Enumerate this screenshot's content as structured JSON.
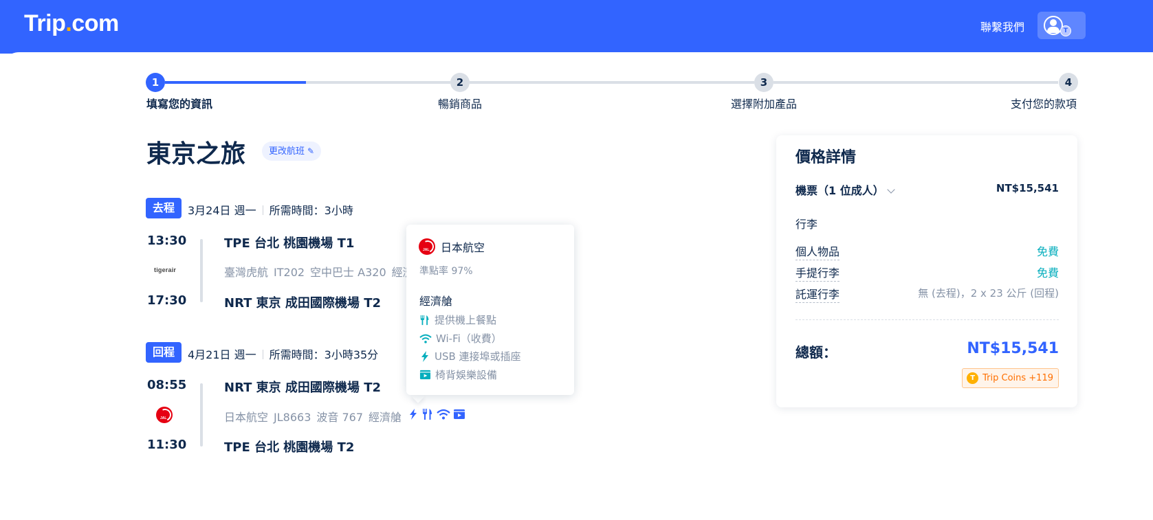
{
  "header": {
    "logo_main": "Trip",
    "logo_dot": ".",
    "logo_suffix": "com",
    "contact_label": "聯繫我們",
    "account_badge": "T"
  },
  "steps": [
    {
      "num": "1",
      "label": "填寫您的資訊",
      "active": true
    },
    {
      "num": "2",
      "label": "暢銷商品",
      "active": false
    },
    {
      "num": "3",
      "label": "選擇附加產品",
      "active": false
    },
    {
      "num": "4",
      "label": "支付您的款項",
      "active": false
    }
  ],
  "trip": {
    "title": "東京之旅",
    "change_label": "更改航班"
  },
  "outbound": {
    "tag": "去程",
    "date": "3月24日 週一",
    "duration": "所需時間：3小時",
    "depart_time": "13:30",
    "arrive_time": "17:30",
    "depart_airport": "TPE 台北 桃園機場 T1",
    "arrive_airport": "NRT 東京 成田國際機場 T2",
    "airline": "臺灣虎航",
    "flight_no": "IT202",
    "aircraft": "空中巴士 A320",
    "cabin": "經濟",
    "airline_logo_text": "tigerair"
  },
  "return": {
    "tag": "回程",
    "date": "4月21日 週一",
    "duration": "所需時間：3小時35分",
    "depart_time": "08:55",
    "arrive_time": "11:30",
    "depart_airport": "NRT 東京 成田國際機場 T2",
    "arrive_airport": "TPE 台北 桃園機場 T2",
    "airline": "日本航空",
    "flight_no": "JL8663",
    "aircraft": "波音 767",
    "cabin": "經濟艙",
    "amenity_icons": [
      "usb-icon",
      "meal-icon",
      "wifi-icon",
      "entertainment-icon"
    ]
  },
  "popover": {
    "airline": "日本航空",
    "ontime": "準點率 97%",
    "cabin": "經濟艙",
    "amenities": [
      {
        "icon": "meal-icon",
        "label": "提供機上餐點"
      },
      {
        "icon": "wifi-icon",
        "label": "Wi-Fi（收費）"
      },
      {
        "icon": "usb-icon",
        "label": "USB 連接埠或插座"
      },
      {
        "icon": "entertainment-icon",
        "label": "椅背娛樂設備"
      }
    ]
  },
  "price": {
    "title": "價格詳情",
    "ticket_label": "機票（1 位成人）",
    "ticket_price": "NT$15,541",
    "baggage_title": "行李",
    "baggage": [
      {
        "label": "個人物品",
        "value": "免費",
        "style": "free"
      },
      {
        "label": "手提行李",
        "value": "免費",
        "style": "free"
      },
      {
        "label": "託運行李",
        "value": "無 (去程)，2 x 23 公斤 (回程)",
        "style": "gray"
      }
    ],
    "total_label": "總額：",
    "total": "NT$15,541",
    "coins_badge": "T",
    "coins": "Trip Coins +119"
  },
  "colors": {
    "brand": "#3264ff",
    "free": "#06aebd",
    "amenity_icon": "#06aebd",
    "coins": "#ff6f00"
  }
}
